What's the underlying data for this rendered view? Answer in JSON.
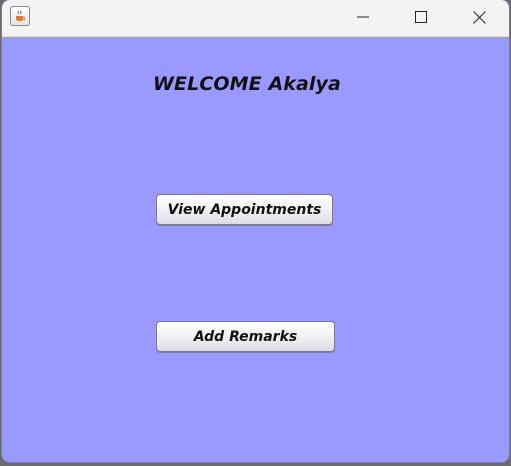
{
  "window": {
    "icon": "java-cup-icon",
    "controls": {
      "minimize": "minimize-icon",
      "maximize": "maximize-icon",
      "close": "close-icon"
    }
  },
  "content": {
    "background_color": "#9999ff",
    "welcome_text": "WELCOME Akalya",
    "buttons": {
      "view_appointments": "View Appointments",
      "add_remarks": "Add Remarks"
    }
  }
}
